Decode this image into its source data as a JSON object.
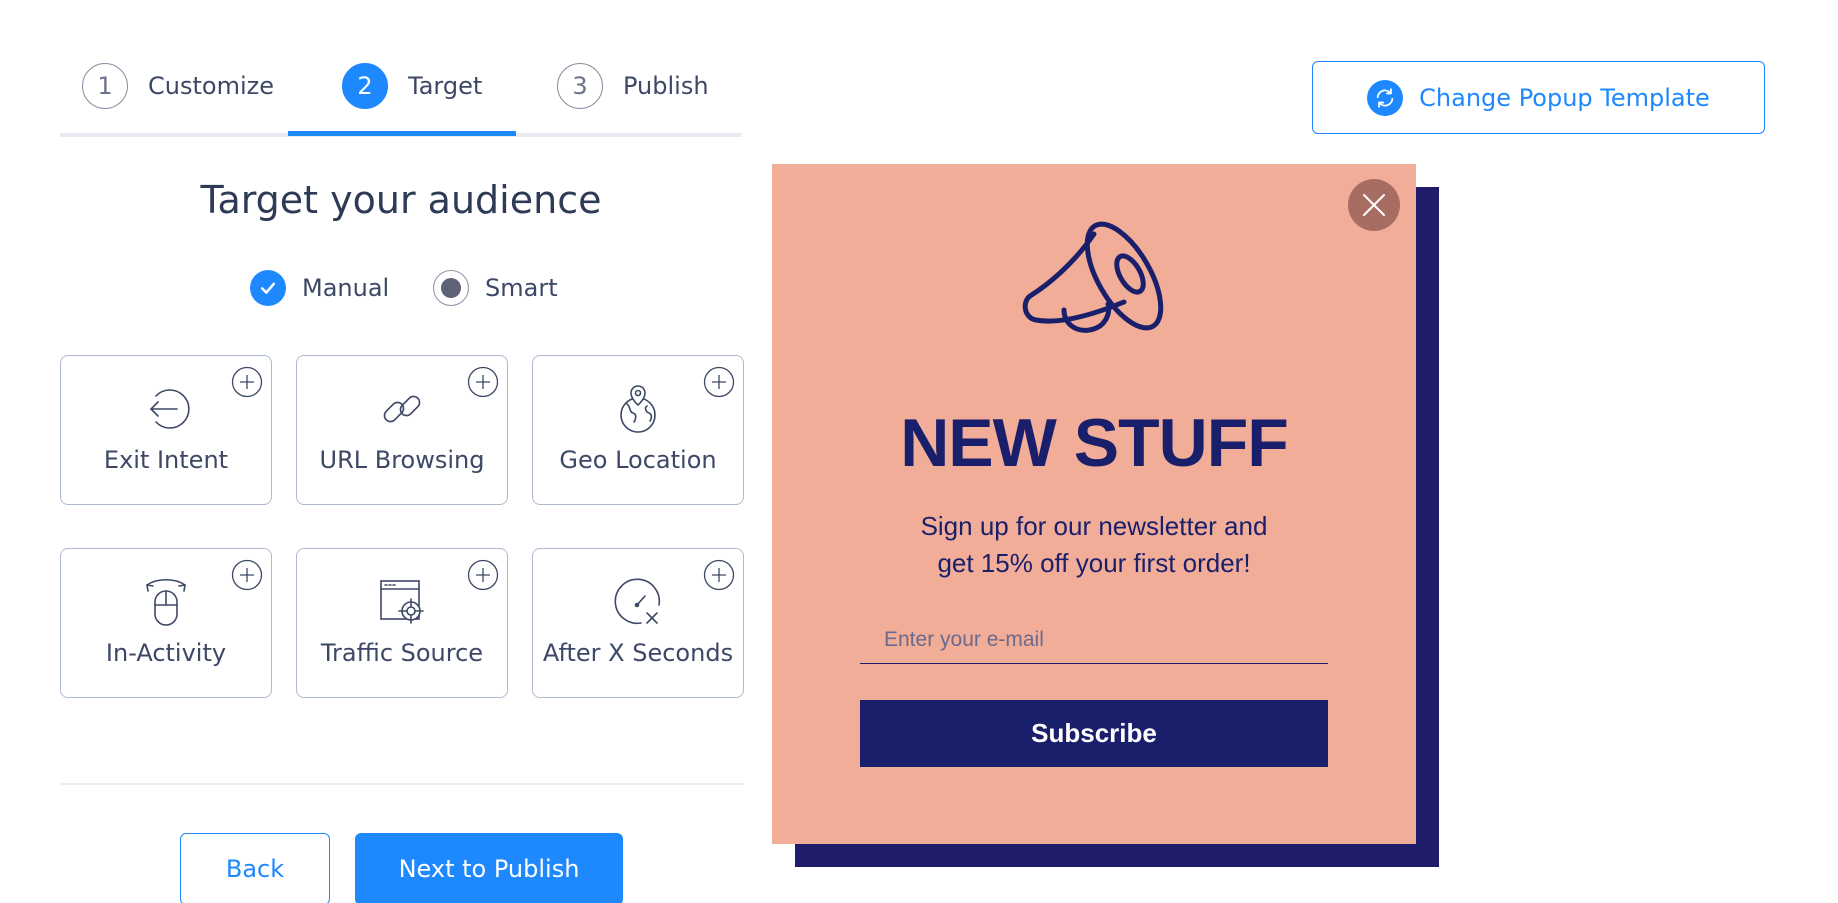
{
  "steps": [
    {
      "num": "1",
      "label": "Customize"
    },
    {
      "num": "2",
      "label": "Target"
    },
    {
      "num": "3",
      "label": "Publish"
    }
  ],
  "template_button": {
    "label": "Change Popup Template",
    "icon": "refresh-icon"
  },
  "heading": "Target your audience",
  "modes": {
    "manual": "Manual",
    "smart": "Smart",
    "selected": "Manual"
  },
  "triggers": [
    {
      "label": "Exit Intent",
      "icon": "exit-intent-icon"
    },
    {
      "label": "URL Browsing",
      "icon": "link-icon"
    },
    {
      "label": "Geo Location",
      "icon": "globe-pin-icon"
    },
    {
      "label": "In-Activity",
      "icon": "mouse-icon"
    },
    {
      "label": "Traffic Source",
      "icon": "target-browser-icon"
    },
    {
      "label": "After X Seconds",
      "icon": "clock-icon"
    }
  ],
  "actions": {
    "back": "Back",
    "next": "Next to Publish"
  },
  "popup": {
    "title": "NEW STUFF",
    "subtitle_line1": "Sign up for our newsletter and",
    "subtitle_line2": "get 15% off your first order!",
    "email_placeholder": "Enter your e-mail",
    "subscribe": "Subscribe",
    "colors": {
      "background": "#f1ad98",
      "accent": "#1a1f6c",
      "shadow": "#1f1d6b",
      "close": "#a86d62"
    }
  },
  "colors": {
    "primary": "#1e88ff",
    "text": "#2f3a56",
    "border": "#aebad1"
  }
}
